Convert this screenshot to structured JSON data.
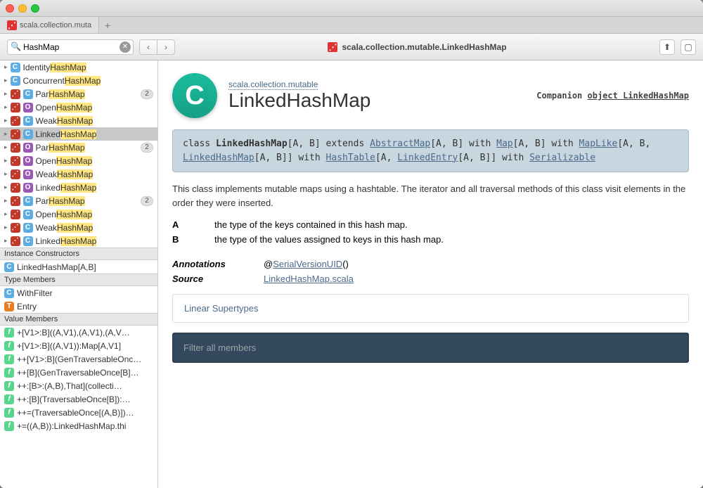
{
  "tab_title": "scala.collection.muta",
  "addr_title": "scala.collection.mutable.LinkedHashMap",
  "search_value": "HashMap",
  "sidebar": {
    "rows": [
      {
        "i1": "C",
        "i2": "",
        "text_pre": "Identity",
        "text_hl": "HashMap",
        "text_post": ""
      },
      {
        "i1": "C",
        "i2": "",
        "text_pre": "Concurrent",
        "text_hl": "HashMap",
        "text_post": ""
      },
      {
        "i1": "red",
        "i2": "C",
        "text_pre": "Par",
        "text_hl": "HashMap",
        "text_post": "",
        "badge": "2"
      },
      {
        "i1": "red",
        "i2": "O",
        "text_pre": "Open",
        "text_hl": "HashMap",
        "text_post": ""
      },
      {
        "i1": "red",
        "i2": "C",
        "text_pre": "Weak",
        "text_hl": "HashMap",
        "text_post": ""
      },
      {
        "i1": "red",
        "i2": "C",
        "text_pre": "Linked",
        "text_hl": "HashMap",
        "text_post": "",
        "sel": true
      },
      {
        "i1": "red",
        "i2": "O",
        "text_pre": "Par",
        "text_hl": "HashMap",
        "text_post": "",
        "badge": "2"
      },
      {
        "i1": "red",
        "i2": "O",
        "text_pre": "Open",
        "text_hl": "HashMap",
        "text_post": ""
      },
      {
        "i1": "red",
        "i2": "O",
        "text_pre": "Weak",
        "text_hl": "HashMap",
        "text_post": ""
      },
      {
        "i1": "red",
        "i2": "O",
        "text_pre": "Linked",
        "text_hl": "HashMap",
        "text_post": ""
      },
      {
        "i1": "red",
        "i2": "C",
        "text_pre": "Par",
        "text_hl": "HashMap",
        "text_post": "",
        "badge": "2"
      },
      {
        "i1": "red",
        "i2": "C",
        "text_pre": "Open",
        "text_hl": "HashMap",
        "text_post": ""
      },
      {
        "i1": "red",
        "i2": "C",
        "text_pre": "Weak",
        "text_hl": "HashMap",
        "text_post": ""
      },
      {
        "i1": "red",
        "i2": "C",
        "text_pre": "Linked",
        "text_hl": "HashMap",
        "text_post": ""
      }
    ],
    "instance_head": "Instance Constructors",
    "instance": [
      {
        "icon": "C",
        "text": "LinkedHashMap[A,B]"
      }
    ],
    "type_head": "Type Members",
    "types": [
      {
        "icon": "C",
        "text": "WithFilter"
      },
      {
        "icon": "T",
        "text": "Entry"
      }
    ],
    "value_head": "Value Members",
    "values": [
      "+[V1>:B]((A,V1),(A,V1),(A,V…",
      "+[V1>:B]((A,V1)):Map[A,V1]",
      "++[V1>:B](GenTraversableOnc…",
      "++[B](GenTraversableOnce[B]…",
      "++:[B>:(A,B),That](collecti…",
      "++:[B](TraversableOnce[B]):…",
      "++=(TraversableOnce[(A,B)])…",
      "+=((A,B)):LinkedHashMap.thi"
    ]
  },
  "content": {
    "breadcrumb": "scala.collection.mutable",
    "title": "LinkedHashMap",
    "companion_pre": "Companion ",
    "companion_link": "object LinkedHashMap",
    "sig": "class  <b>LinkedHashMap</b>[A, B] extends <a>AbstractMap</a>[A, B] with <a>Map</a>[A, B] with <a>MapLike</a>[A, B, <a>LinkedHashMap</a>[A, B]] with <a>HashTable</a>[A, <a>LinkedEntry</a>[A, B]] with <a>Serializable</a>",
    "desc": "This class implements mutable maps using a hashtable. The iterator and all traversal methods of this class visit elements in the order they were inserted.",
    "tA": "the type of the keys contained in this hash map.",
    "tB": "the type of the values assigned to keys in this hash map.",
    "annotations_label": "Annotations",
    "annotations_value_pre": "@",
    "annotations_link": "SerialVersionUID",
    "annotations_value_post": "()",
    "source_label": "Source",
    "source_link": "LinkedHashMap.scala",
    "linear": "Linear Supertypes",
    "filter_placeholder": "Filter all members"
  }
}
